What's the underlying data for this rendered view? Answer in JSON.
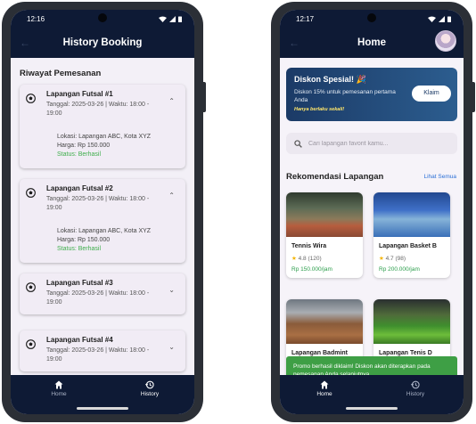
{
  "left_phone": {
    "status_time": "12:16",
    "title": "History Booking",
    "section_title": "Riwayat Pemesanan",
    "bookings": [
      {
        "name": "Lapangan Futsal #1",
        "datetime": "Tanggal: 2025-03-26 | Waktu: 18:00 - 19:00",
        "expanded": true,
        "location": "Lokasi: Lapangan ABC, Kota XYZ",
        "price": "Harga: Rp 150.000",
        "status": "Status: Berhasil"
      },
      {
        "name": "Lapangan Futsal #2",
        "datetime": "Tanggal: 2025-03-26 | Waktu: 18:00 - 19:00",
        "expanded": true,
        "location": "Lokasi: Lapangan ABC, Kota XYZ",
        "price": "Harga: Rp 150.000",
        "status": "Status: Berhasil"
      },
      {
        "name": "Lapangan Futsal #3",
        "datetime": "Tanggal: 2025-03-26 | Waktu: 18:00 - 19:00",
        "expanded": false
      },
      {
        "name": "Lapangan Futsal #4",
        "datetime": "Tanggal: 2025-03-26 | Waktu: 18:00 - 19:00",
        "expanded": false
      }
    ],
    "nav": [
      {
        "label": "Home",
        "icon": "home-icon",
        "active": false
      },
      {
        "label": "History",
        "icon": "history-icon",
        "active": true
      }
    ]
  },
  "right_phone": {
    "status_time": "12:17",
    "title": "Home",
    "promo": {
      "title": "Diskon Spesial! 🎉",
      "description": "Diskon 15% untuk pemesanan pertama Anda",
      "note": "Hanya berlaku sekali!",
      "button": "Klaim"
    },
    "search": {
      "placeholder": "Cari lapangan favorit kamu..."
    },
    "recommend_title": "Rekomendasi Lapangan",
    "see_all": "Lihat Semua",
    "fields": [
      {
        "name": "Tennis Wira",
        "rating": "4.8 (120)",
        "price": "Rp 150.000/jam"
      },
      {
        "name": "Lapangan Basket B",
        "rating": "4.7 (98)",
        "price": "Rp 200.000/jam"
      },
      {
        "name": "Lapangan Badmint",
        "rating": "",
        "price": ""
      },
      {
        "name": "Lapangan Tenis D",
        "rating": "",
        "price": ""
      }
    ],
    "snackbar": "Promo berhasil diklaim! Diskon akan diterapkan pada pemesanan Anda selanjutnya.",
    "nav": [
      {
        "label": "Home",
        "icon": "home-icon",
        "active": true
      },
      {
        "label": "History",
        "icon": "history-icon",
        "active": false
      }
    ]
  },
  "colors": {
    "appbar": "#0e1a35",
    "success": "#3fae4c",
    "link": "#2a6fd6",
    "star": "#f4b400"
  }
}
